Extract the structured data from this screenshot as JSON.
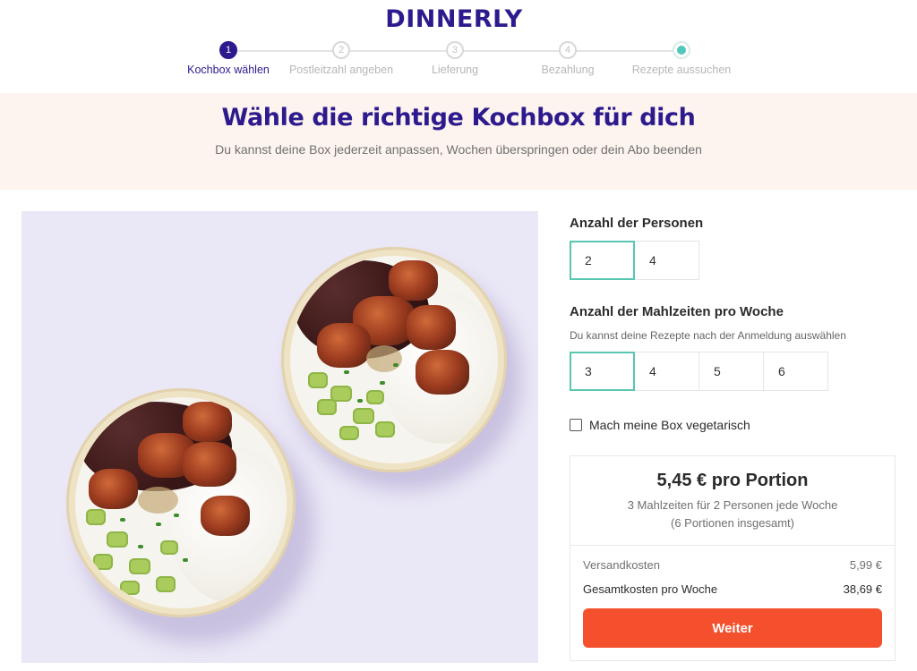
{
  "brand": {
    "logo_text": "DINNERLY",
    "brand_color": "#2d1b8e"
  },
  "stepper": {
    "steps": [
      {
        "number": "1",
        "label": "Kochbox wählen",
        "state": "active"
      },
      {
        "number": "2",
        "label": "Postleitzahl angeben",
        "state": "upcoming"
      },
      {
        "number": "3",
        "label": "Lieferung",
        "state": "upcoming"
      },
      {
        "number": "4",
        "label": "Bezahlung",
        "state": "upcoming"
      },
      {
        "number": "",
        "label": "Rezepte aussuchen",
        "state": "final"
      }
    ]
  },
  "banner": {
    "title": "Wähle die richtige Kochbox für dich",
    "subtitle": "Du kannst deine Box jederzeit anpassen, Wochen überspringen oder dein Abo beenden"
  },
  "options": {
    "persons": {
      "title": "Anzahl der Personen",
      "choices": [
        "2",
        "4"
      ],
      "selected": "2"
    },
    "meals": {
      "title": "Anzahl der Mahlzeiten pro Woche",
      "hint": "Du kannst deine Rezepte nach der Anmeldung auswählen",
      "choices": [
        "3",
        "4",
        "5",
        "6"
      ],
      "selected": "3"
    },
    "vegetarian": {
      "label": "Mach meine Box vegetarisch",
      "checked": false
    }
  },
  "pricing": {
    "per_portion": "5,45 € pro Portion",
    "summary_line1": "3 Mahlzeiten für 2 Personen jede Woche",
    "summary_line2": "(6 Portionen insgesamt)",
    "shipping_label": "Versandkosten",
    "shipping_value": "5,99 €",
    "total_label": "Gesamtkosten pro Woche",
    "total_value": "38,69 €"
  },
  "cta": {
    "label": "Weiter",
    "color": "#f5502e"
  },
  "accent_color": "#59c6b2"
}
